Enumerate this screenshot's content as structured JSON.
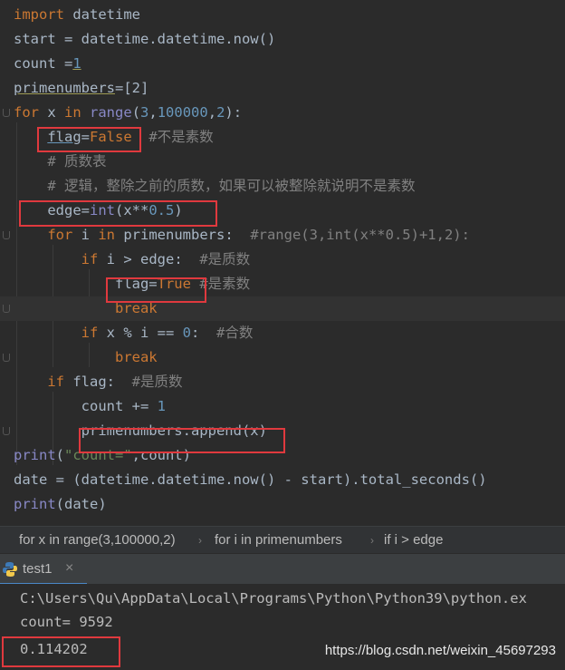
{
  "editor": {
    "lines": [
      {
        "segments": [
          {
            "t": "import",
            "c": "kw"
          },
          {
            "t": " datetime"
          }
        ]
      },
      {
        "segments": [
          {
            "t": "start = datetime.datetime.now()"
          }
        ]
      },
      {
        "segments": [
          {
            "t": "count ="
          },
          {
            "t": "1",
            "c": "num und"
          }
        ]
      },
      {
        "segments": [
          {
            "t": "primenumbers",
            "c": "und"
          },
          {
            "t": "=[2]"
          }
        ]
      },
      {
        "segments": [
          {
            "t": "for",
            "c": "kw"
          },
          {
            "t": " x "
          },
          {
            "t": "in",
            "c": "kw"
          },
          {
            "t": " "
          },
          {
            "t": "range",
            "c": "bi"
          },
          {
            "t": "("
          },
          {
            "t": "3",
            "c": "num"
          },
          {
            "t": ","
          },
          {
            "t": "100000",
            "c": "num"
          },
          {
            "t": ","
          },
          {
            "t": "2",
            "c": "num"
          },
          {
            "t": "):"
          }
        ]
      },
      {
        "segments": [
          {
            "t": "    "
          },
          {
            "t": "flag",
            "c": "und-blue"
          },
          {
            "t": "="
          },
          {
            "t": "False",
            "c": "kw"
          },
          {
            "t": "  "
          },
          {
            "t": "#不是素数",
            "c": "cmt"
          }
        ]
      },
      {
        "segments": [
          {
            "t": "    "
          },
          {
            "t": "# 质数表",
            "c": "cmt"
          }
        ]
      },
      {
        "segments": [
          {
            "t": "    "
          },
          {
            "t": "# 逻辑，整除之前的质数，如果可以被整除就说明不是素数",
            "c": "cmt"
          }
        ]
      },
      {
        "segments": [
          {
            "t": "    edge="
          },
          {
            "t": "int",
            "c": "bi"
          },
          {
            "t": "(x**"
          },
          {
            "t": "0.5",
            "c": "num"
          },
          {
            "t": ")"
          }
        ]
      },
      {
        "segments": [
          {
            "t": "    "
          },
          {
            "t": "for",
            "c": "kw"
          },
          {
            "t": " i "
          },
          {
            "t": "in",
            "c": "kw"
          },
          {
            "t": " primenumbers:  "
          },
          {
            "t": "#range(3,int(x**0.5)+1,2):",
            "c": "cmt"
          }
        ]
      },
      {
        "segments": [
          {
            "t": "        "
          },
          {
            "t": "if",
            "c": "kw"
          },
          {
            "t": " i > edge:  "
          },
          {
            "t": "#是质数",
            "c": "cmt"
          }
        ]
      },
      {
        "segments": [
          {
            "t": "            flag="
          },
          {
            "t": "True",
            "c": "kw"
          },
          {
            "t": " "
          },
          {
            "t": "#是素数",
            "c": "cmt"
          }
        ]
      },
      {
        "segments": [
          {
            "t": "            "
          },
          {
            "t": "break",
            "c": "kw"
          }
        ],
        "current": true
      },
      {
        "segments": [
          {
            "t": "        "
          },
          {
            "t": "if",
            "c": "kw"
          },
          {
            "t": " x % i == "
          },
          {
            "t": "0",
            "c": "num"
          },
          {
            "t": ":  "
          },
          {
            "t": "#合数",
            "c": "cmt"
          }
        ]
      },
      {
        "segments": [
          {
            "t": "            "
          },
          {
            "t": "break",
            "c": "kw"
          }
        ]
      },
      {
        "segments": [
          {
            "t": "    "
          },
          {
            "t": "if",
            "c": "kw"
          },
          {
            "t": " flag:  "
          },
          {
            "t": "#是质数",
            "c": "cmt"
          }
        ]
      },
      {
        "segments": [
          {
            "t": "        count += "
          },
          {
            "t": "1",
            "c": "num"
          }
        ]
      },
      {
        "segments": [
          {
            "t": "        primenumbers.append(x)"
          }
        ]
      },
      {
        "segments": [
          {
            "t": "print",
            "c": "bi"
          },
          {
            "t": "("
          },
          {
            "t": "\"count=\"",
            "c": "str"
          },
          {
            "t": ","
          },
          {
            "t": "count)"
          }
        ]
      },
      {
        "segments": [
          {
            "t": "date = (datetime.datetime.now() - start).total_seconds()"
          }
        ]
      },
      {
        "segments": [
          {
            "t": "print",
            "c": "bi"
          },
          {
            "t": "(date)"
          }
        ]
      }
    ]
  },
  "breadcrumb": {
    "items": [
      "for x in range(3,100000,2)",
      "for i in primenumbers",
      "if i > edge"
    ],
    "separator": "›"
  },
  "run": {
    "tab_label": "test1",
    "close_symbol": "×"
  },
  "console": {
    "lines": [
      "C:\\Users\\Qu\\AppData\\Local\\Programs\\Python\\Python39\\python.ex",
      "count= 9592",
      "0.114202"
    ]
  },
  "watermark": "https://blog.csdn.net/weixin_45697293",
  "colors": {
    "highlight_box": "#e0393e",
    "keyword": "#cc7832",
    "number": "#6897bb",
    "comment": "#808080",
    "string": "#6a8759"
  }
}
